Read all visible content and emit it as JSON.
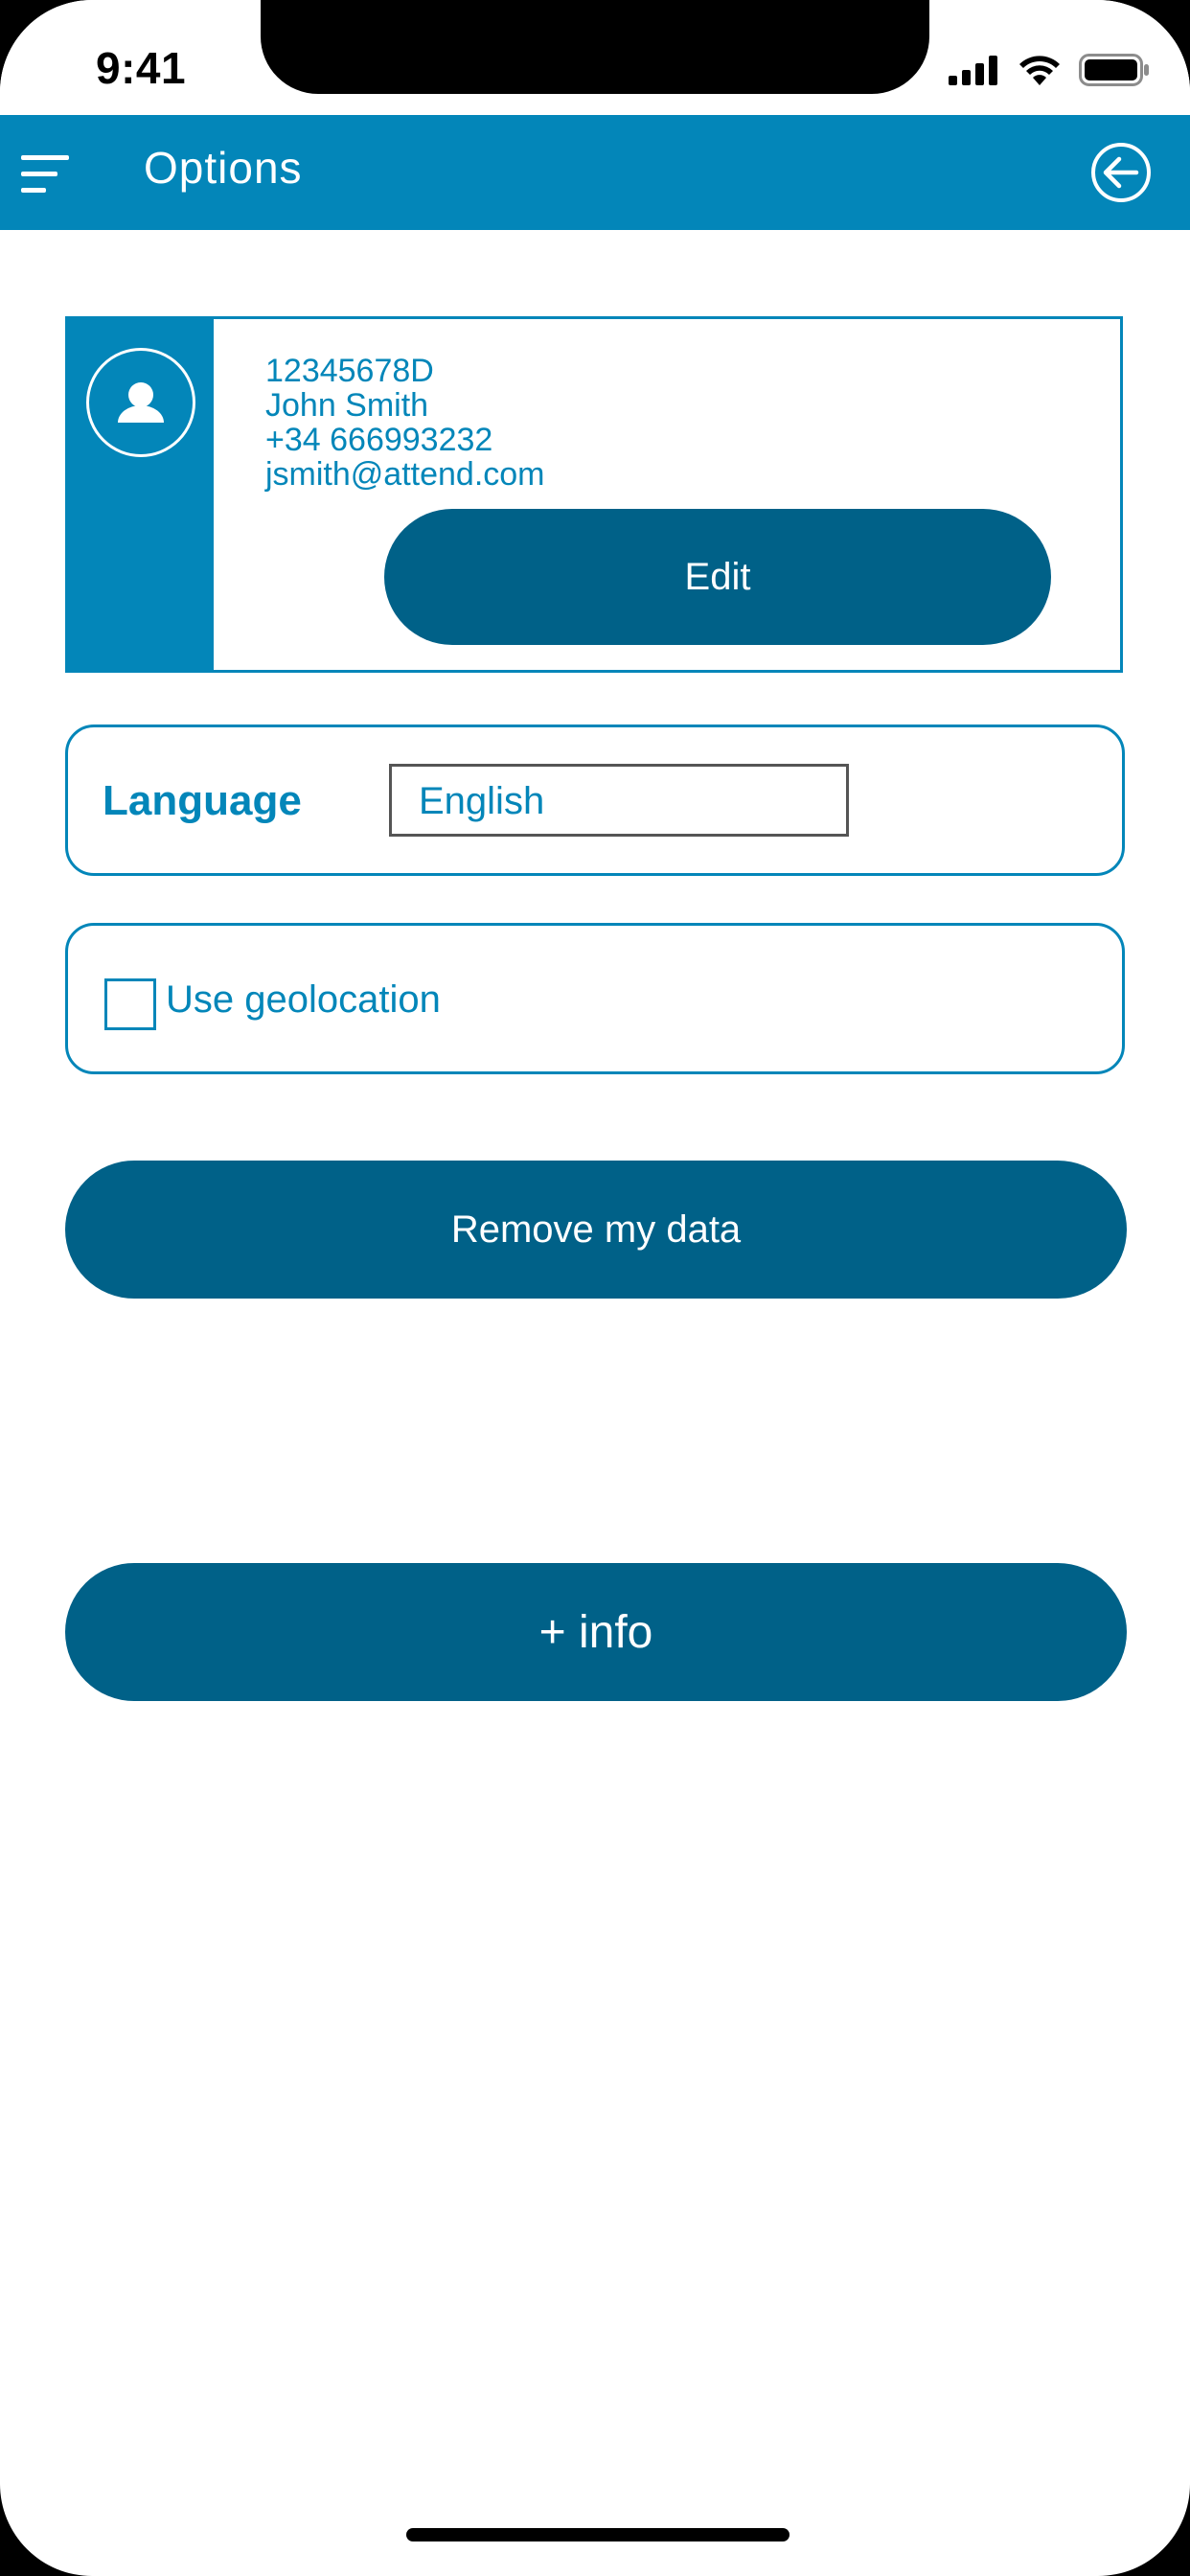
{
  "status_bar": {
    "time": "9:41",
    "icons": [
      "cellular-signal-icon",
      "wifi-icon",
      "battery-icon"
    ]
  },
  "header": {
    "title": "Options",
    "menu_icon": "hamburger-menu-icon",
    "back_icon": "back-arrow-circle-icon",
    "background_color": "#0386b9"
  },
  "profile": {
    "avatar_icon": "user-avatar-icon",
    "id": "12345678D",
    "name": "John Smith",
    "phone": "+34 666993232",
    "email": "jsmith@attend.com",
    "edit_label": "Edit"
  },
  "language": {
    "label": "Language",
    "selected": "English"
  },
  "geolocation": {
    "label": "Use geolocation",
    "checked": false
  },
  "actions": {
    "remove_label": "Remove my data",
    "info_label": "+ info"
  },
  "colors": {
    "primary": "#0386b9",
    "button": "#006188",
    "background": "#ffffff"
  }
}
